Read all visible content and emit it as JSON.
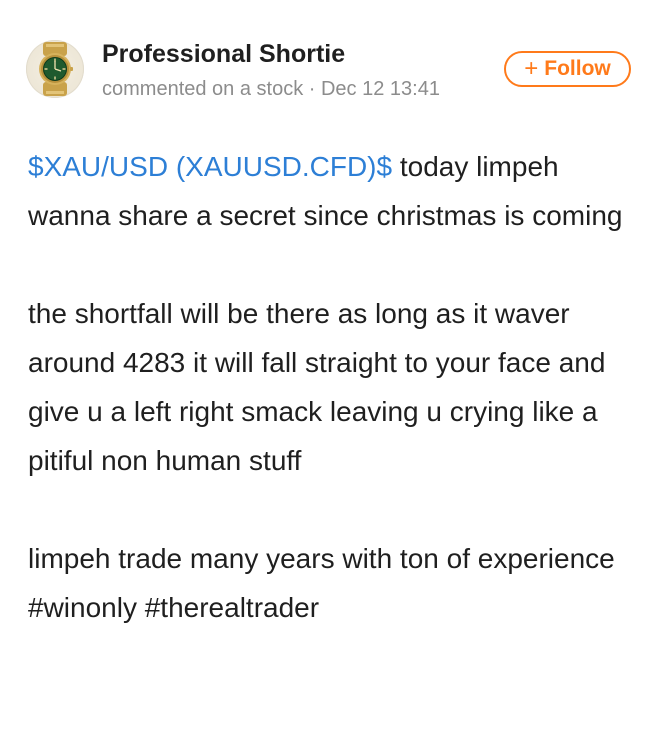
{
  "author": {
    "name": "Professional Shortie",
    "meta": "commented on a stock · Dec 12 13:41"
  },
  "follow": {
    "plus": "+",
    "label": "Follow"
  },
  "colors": {
    "accent": "#ff7a1a",
    "link": "#2d7fd6",
    "text": "#1f1f1f",
    "muted": "#8c8c8c"
  },
  "post": {
    "ticker": "$XAU/USD (XAUUSD.CFD)$",
    "p1_rest": " today limpeh wanna share a secret since christmas is coming",
    "p2": "the shortfall will be there as long as it waver around 4283 it will fall straight to your face and give u a left right smack leaving u crying like a pitiful non human stuff",
    "p3": "limpeh trade many years with ton of experience #winonly #therealtrader"
  }
}
